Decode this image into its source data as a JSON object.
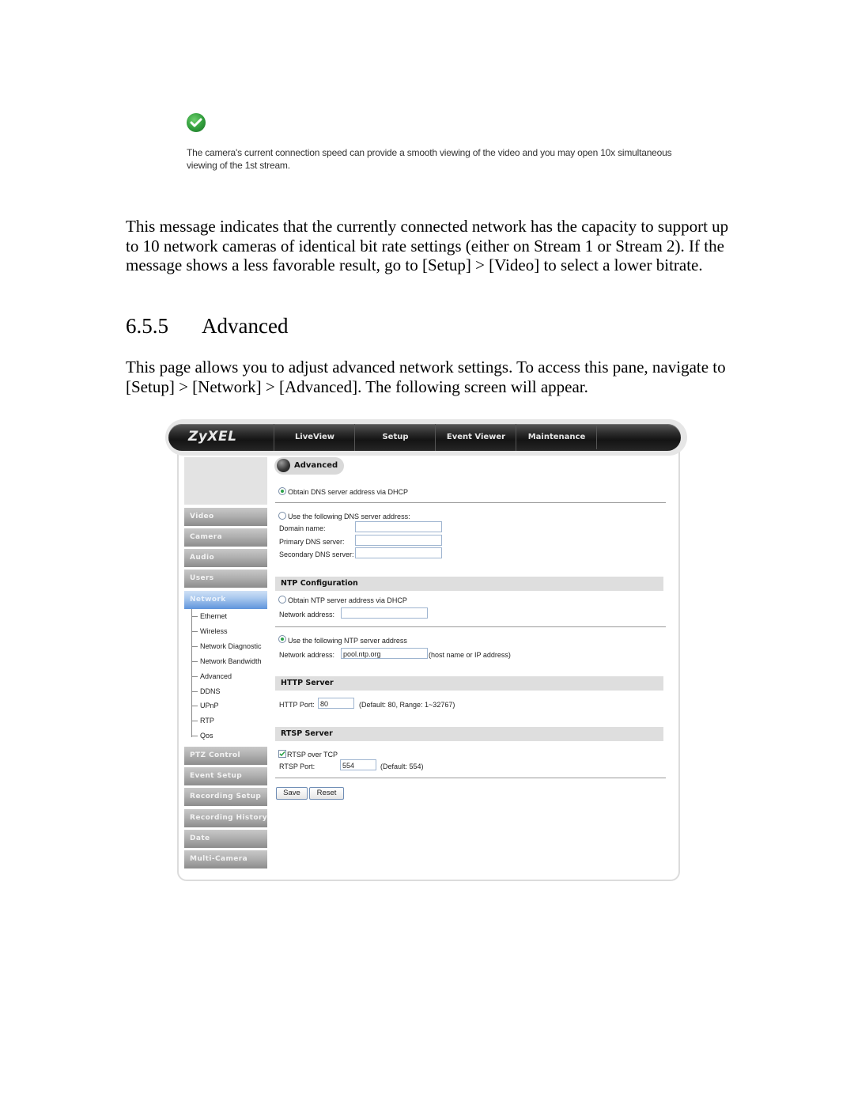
{
  "status_excerpt": {
    "icon": "check-circle-icon",
    "message": "The camera's current connection speed can provide a smooth viewing of the video and you may open 10x simultaneous viewing of the 1st stream."
  },
  "paragraph_1": "This message indicates that the currently connected network has the capacity to support up to 10 network cameras of identical bit rate settings (either on Stream 1 or Stream 2). If the message shows a less favorable result, go to [Setup] > [Video] to select a lower bitrate.",
  "section": {
    "number": "6.5.5",
    "title": "Advanced"
  },
  "paragraph_2": "This page allows you to adjust advanced network settings. To access this pane, navigate to [Setup] > [Network] > [Advanced]. The following screen will appear.",
  "ui": {
    "logo": "ZyXEL",
    "nav": [
      "LiveView",
      "Setup",
      "Event Viewer",
      "Maintenance"
    ],
    "sidebar": {
      "items_top": [
        "Video",
        "Camera",
        "Audio",
        "Users",
        "Network"
      ],
      "active": "Network",
      "network_sub": [
        "Ethernet",
        "Wireless",
        "Network Diagnostic",
        "Network Bandwidth",
        "Advanced",
        "DDNS",
        "UPnP",
        "RTP",
        "Qos"
      ],
      "items_bottom": [
        "PTZ Control",
        "Event Setup",
        "Recording Setup",
        "Recording History",
        "Date",
        "Multi-Camera"
      ]
    },
    "page_title": "Advanced",
    "dns": {
      "opt_dhcp": "Obtain DNS server address via DHCP",
      "opt_dhcp_selected": true,
      "opt_manual": "Use the following DNS server address:",
      "opt_manual_selected": false,
      "domain_label": "Domain name:",
      "domain_value": "",
      "primary_label": "Primary DNS server:",
      "primary_value": "",
      "secondary_label": "Secondary DNS server:",
      "secondary_value": ""
    },
    "ntp": {
      "header": "NTP Configuration",
      "opt_dhcp": "Obtain NTP server address via DHCP",
      "opt_dhcp_selected": false,
      "dhcp_addr_label": "Network address:",
      "dhcp_addr_value": "",
      "opt_manual": "Use the following NTP server address",
      "opt_manual_selected": true,
      "manual_addr_label": "Network address:",
      "manual_addr_value": "pool.ntp.org",
      "manual_addr_hint": "(host name or IP address)"
    },
    "http": {
      "header": "HTTP Server",
      "port_label": "HTTP Port:",
      "port_value": "80",
      "port_hint": "(Default: 80, Range: 1~32767)"
    },
    "rtsp": {
      "header": "RTSP Server",
      "over_tcp_label": "RTSP over TCP",
      "over_tcp_checked": true,
      "port_label": "RTSP Port:",
      "port_value": "554",
      "port_hint": "(Default: 554)"
    },
    "buttons": {
      "save": "Save",
      "reset": "Reset"
    }
  }
}
